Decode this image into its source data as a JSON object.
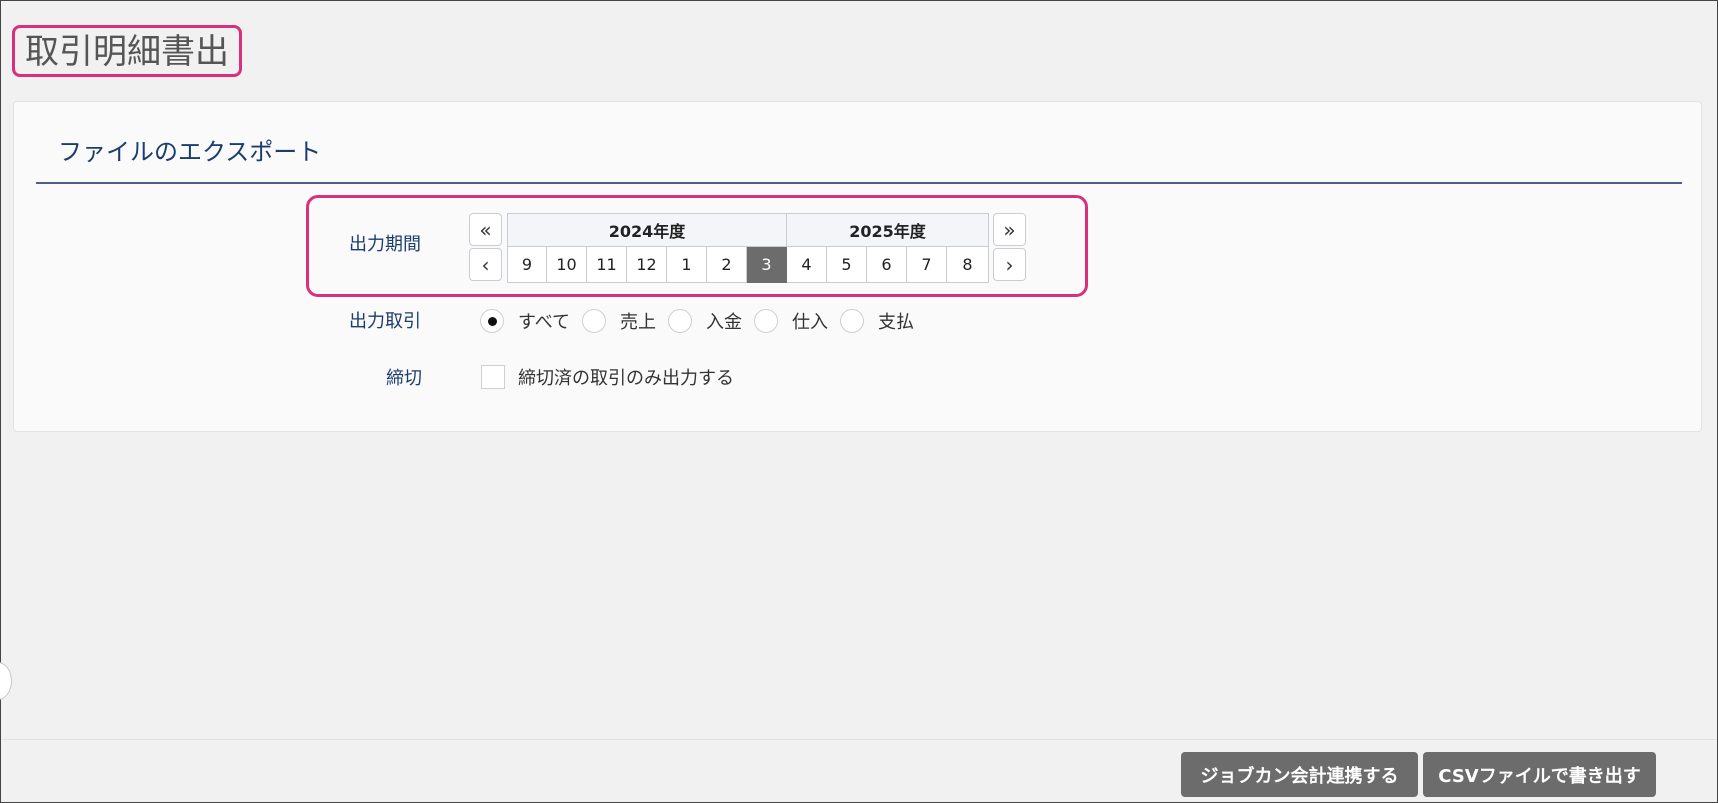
{
  "page": {
    "title": "取引明細書出"
  },
  "export": {
    "section_title": "ファイルのエクスポート",
    "period": {
      "label": "出力期間",
      "years": [
        {
          "label": "2024年度",
          "months": [
            "9",
            "10",
            "11",
            "12",
            "1",
            "2",
            "3"
          ]
        },
        {
          "label": "2025年度",
          "months": [
            "4",
            "5",
            "6",
            "7",
            "8"
          ]
        }
      ],
      "selected_month": "3",
      "nav": {
        "first": "«",
        "prev": "‹",
        "last": "»",
        "next": "›"
      }
    },
    "transactions": {
      "label": "出力取引",
      "options": [
        {
          "label": "すべて",
          "selected": true
        },
        {
          "label": "売上",
          "selected": false
        },
        {
          "label": "入金",
          "selected": false
        },
        {
          "label": "仕入",
          "selected": false
        },
        {
          "label": "支払",
          "selected": false
        }
      ]
    },
    "closing": {
      "label": "締切",
      "checkbox_label": "締切済の取引のみ出力する",
      "checked": false
    }
  },
  "footer": {
    "jobcan_button": "ジョブカン会計連携する",
    "csv_button": "CSVファイルで書き出す"
  },
  "colors": {
    "highlight": "#d8307a",
    "accent": "#1d3c6e",
    "button": "#6c6c6c"
  }
}
